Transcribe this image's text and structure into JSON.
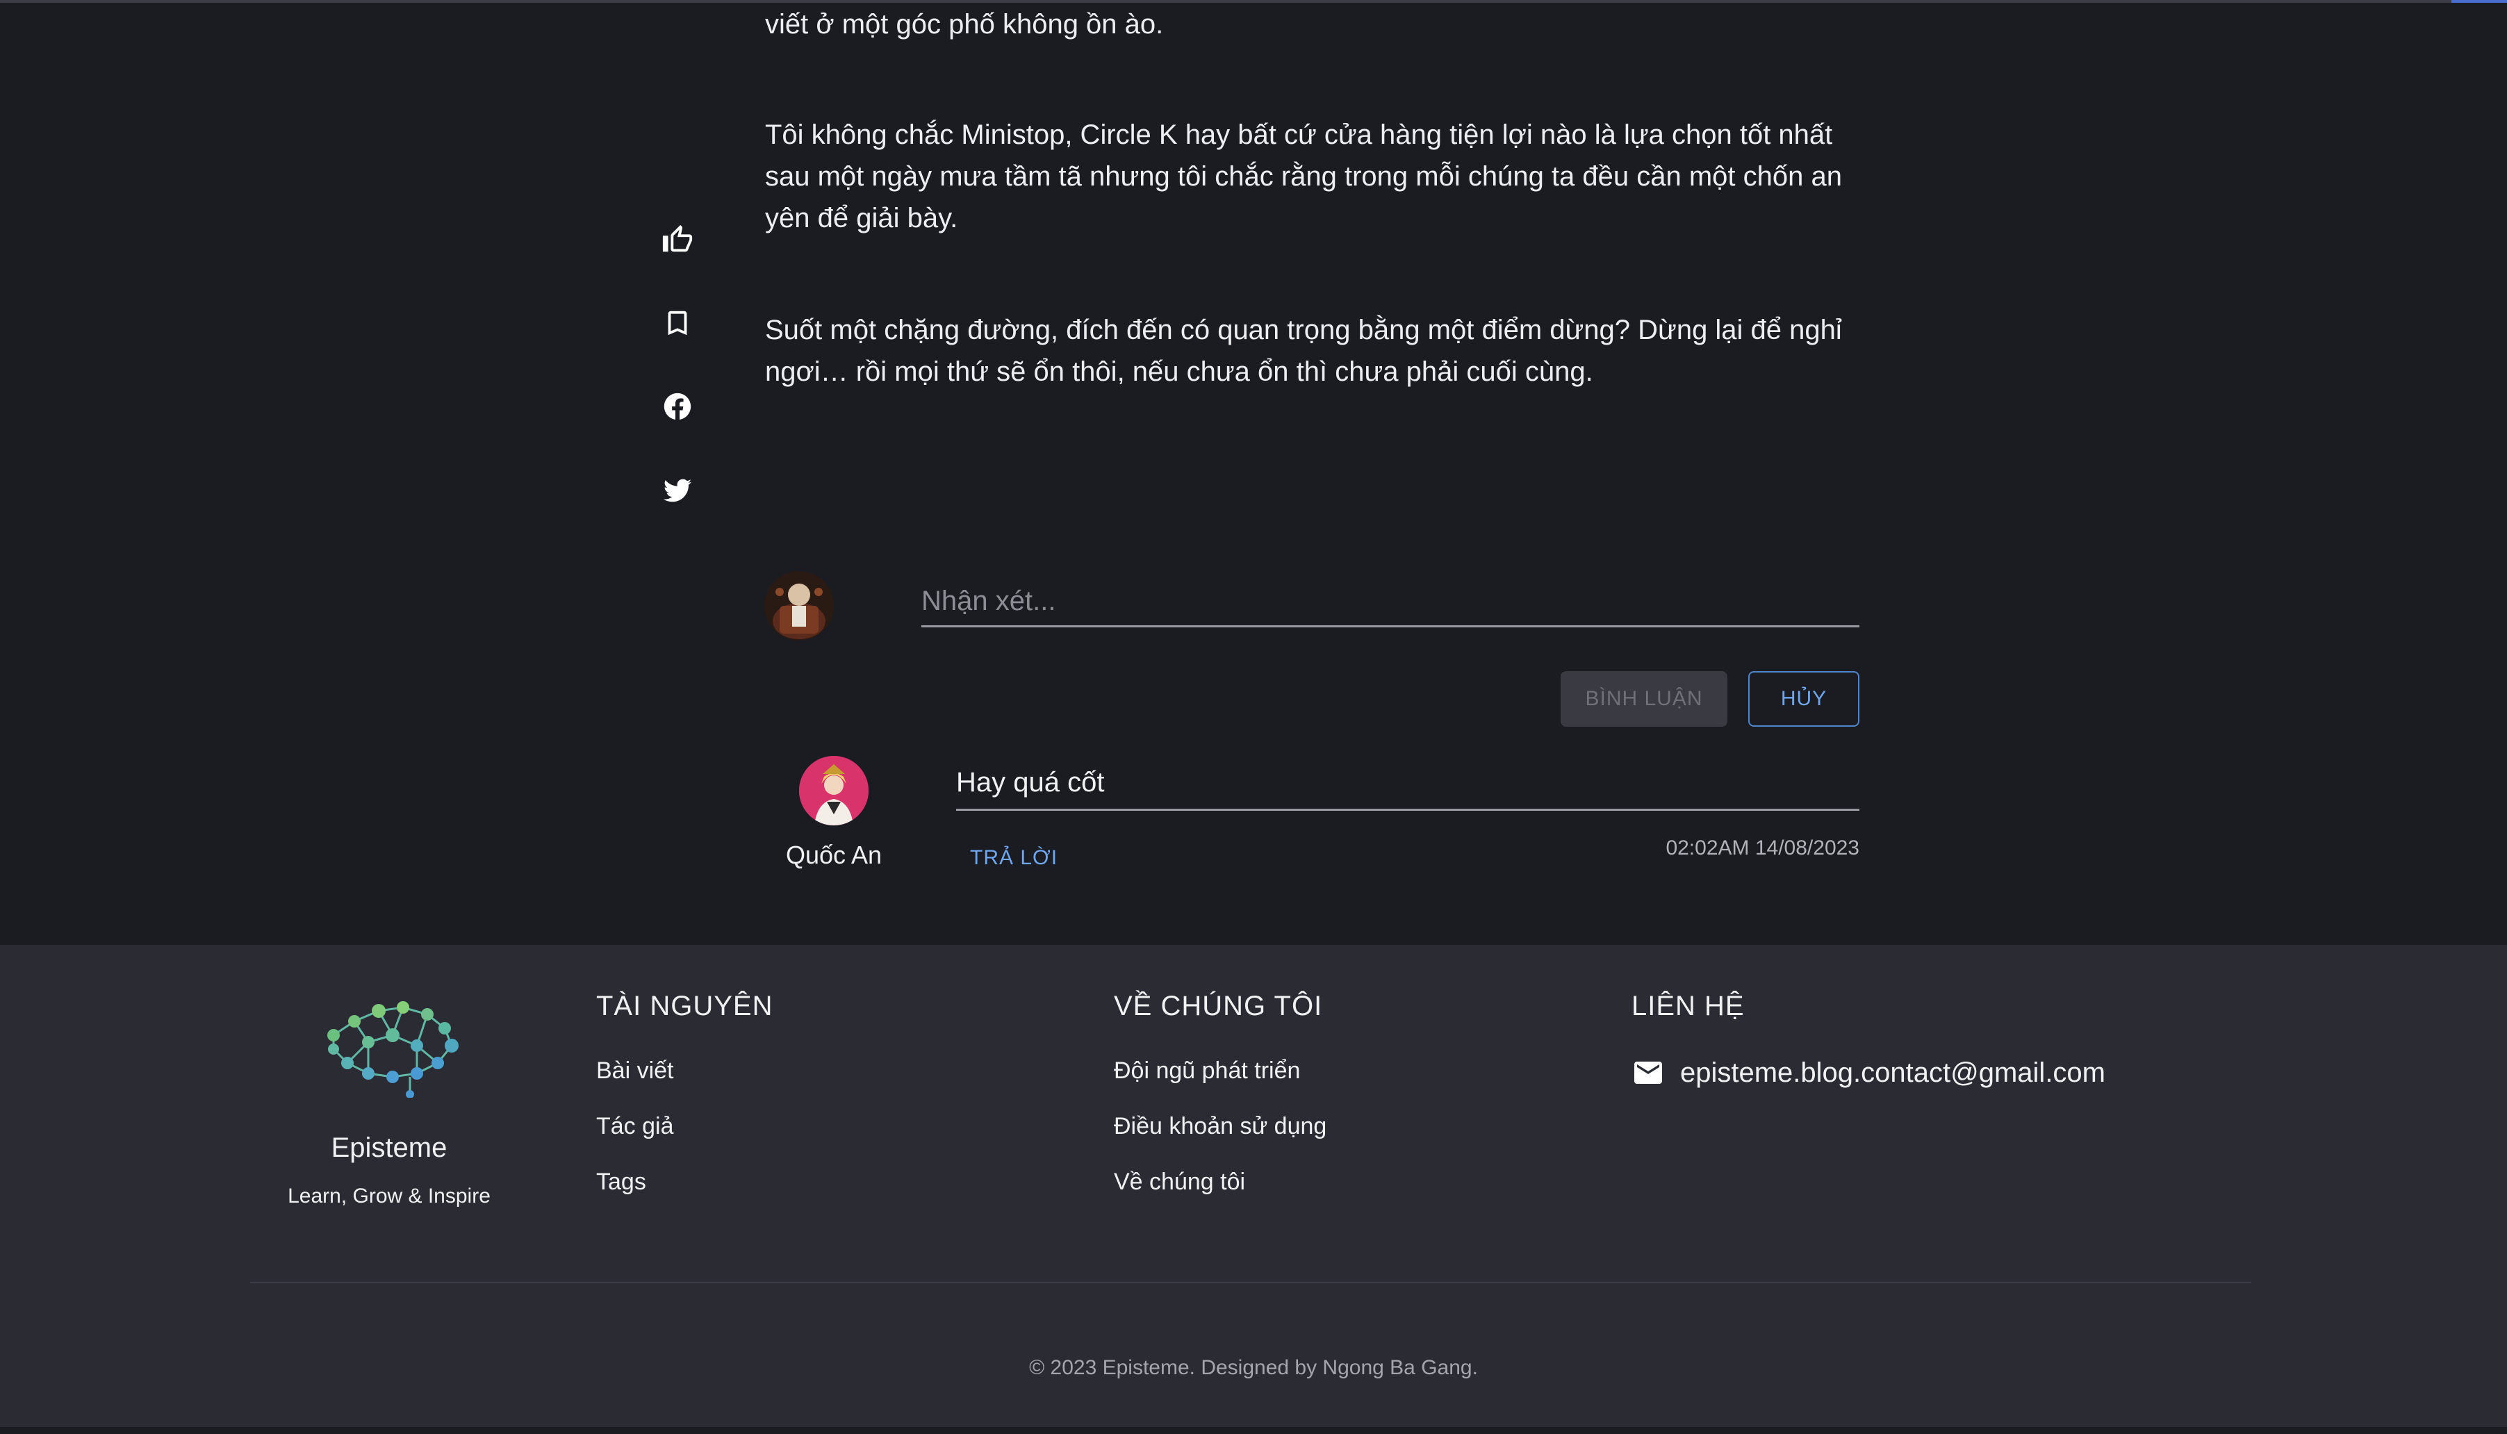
{
  "article": {
    "paragraphs": [
      "viết ở một góc phố không ồn ào.",
      "Tôi không chắc Ministop, Circle K hay bất cứ cửa hàng tiện lợi nào là lựa chọn tốt nhất sau một ngày mưa tầm tã nhưng tôi chắc rằng trong mỗi chúng ta đều cần một chốn an yên để giải bày.",
      "Suốt một chặng đường, đích đến có quan trọng bằng một điểm dừng? Dừng lại để nghỉ ngơi… rồi mọi thứ sẽ ổn thôi, nếu chưa ổn thì chưa phải cuối cùng."
    ]
  },
  "side_actions": {
    "icons": [
      "thumb-up-icon",
      "bookmark-icon",
      "facebook-icon",
      "twitter-icon"
    ]
  },
  "comment_form": {
    "placeholder": "Nhận xét...",
    "submit_label": "BÌNH LUẬN",
    "cancel_label": "HỦY"
  },
  "comments": [
    {
      "author": "Quốc An",
      "text": "Hay quá cốt",
      "reply_label": "TRẢ LỜI",
      "time": "02:02AM 14/08/2023"
    }
  ],
  "footer": {
    "brand": {
      "name": "Episteme",
      "tagline": "Learn, Grow & Inspire"
    },
    "columns": [
      {
        "title": "TÀI NGUYÊN",
        "links": [
          "Bài viết",
          "Tác giả",
          "Tags"
        ]
      },
      {
        "title": "VỀ CHÚNG TÔI",
        "links": [
          "Đội ngũ phát triển",
          "Điều khoản sử dụng",
          "Về chúng tôi"
        ]
      },
      {
        "title": "LIÊN HỆ",
        "links": []
      }
    ],
    "contact_email": "episteme.blog.contact@gmail.com",
    "copyright": "© 2023 Episteme. Designed by Ngong Ba Gang."
  },
  "colors": {
    "background": "#1b1c22",
    "footer_background": "#2a2b33",
    "accent_blue": "#6ea7ef",
    "avatar_pink": "#d8336b"
  }
}
